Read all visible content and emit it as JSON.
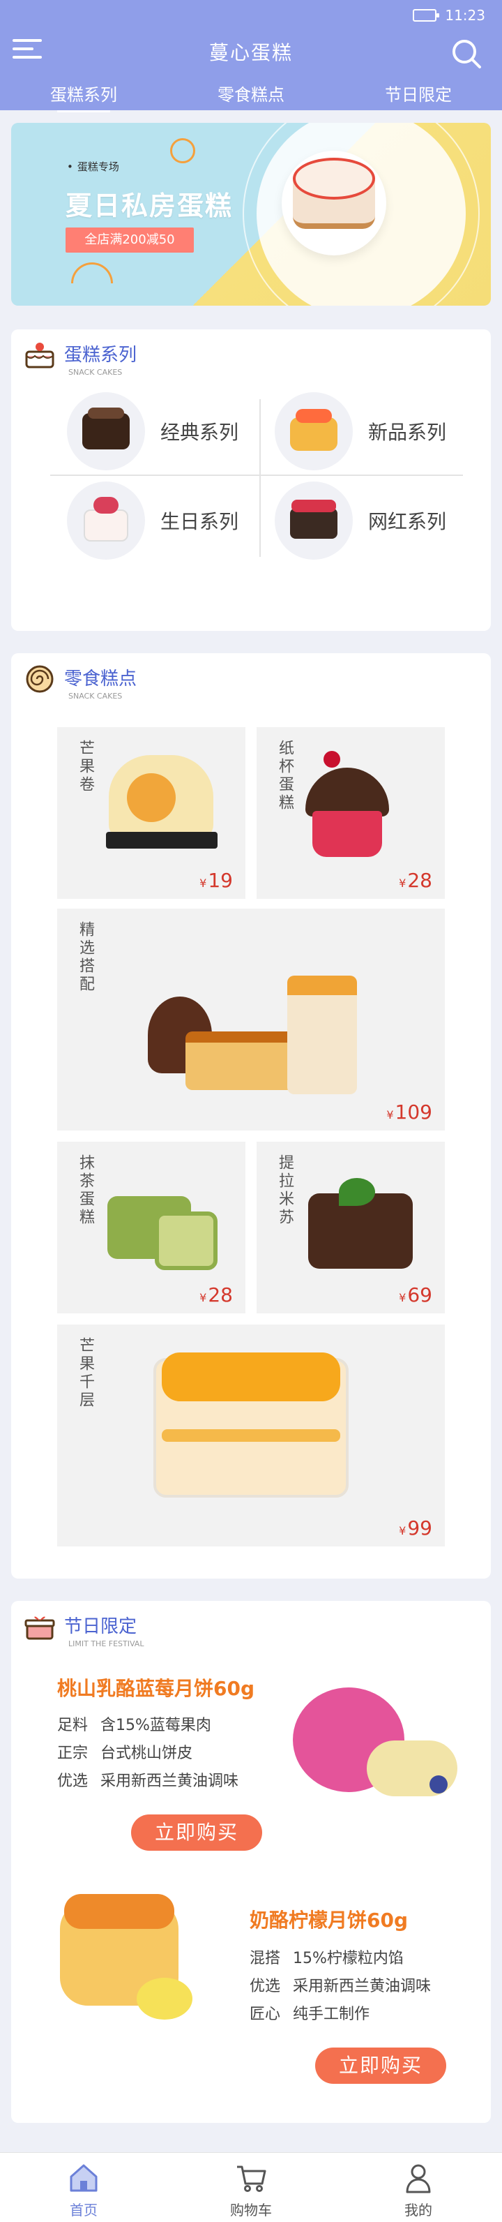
{
  "status_bar": {
    "time": "11:23"
  },
  "header": {
    "title": "蔓心蛋糕",
    "tabs": [
      {
        "label": "蛋糕系列",
        "active": true
      },
      {
        "label": "零食糕点",
        "active": false
      },
      {
        "label": "节日限定",
        "active": false
      }
    ]
  },
  "banner": {
    "subtitle": "蛋糕专场",
    "title": "夏日私房蛋糕",
    "promo": "全店满200减50"
  },
  "cake_series": {
    "title": "蛋糕系列",
    "subtitle": "SNACK CAKES",
    "items": [
      {
        "label": "经典系列"
      },
      {
        "label": "新品系列"
      },
      {
        "label": "生日系列"
      },
      {
        "label": "网红系列"
      }
    ]
  },
  "snacks": {
    "title": "零食糕点",
    "subtitle": "SNACK CAKES",
    "currency": "¥",
    "items": [
      {
        "name": "芒果卷",
        "price": "19"
      },
      {
        "name": "纸杯蛋糕",
        "price": "28"
      },
      {
        "name": "精选搭配",
        "price": "109"
      },
      {
        "name": "抹茶蛋糕",
        "price": "28"
      },
      {
        "name": "提拉米苏",
        "price": "69"
      },
      {
        "name": "芒果千层",
        "price": "99"
      }
    ]
  },
  "festival": {
    "title": "节日限定",
    "subtitle": "LIMIT THE FESTIVAL",
    "products": [
      {
        "name": "桃山乳酪蓝莓月饼60g",
        "details": [
          {
            "key": "足料",
            "value": "含15%蓝莓果肉"
          },
          {
            "key": "正宗",
            "value": "台式桃山饼皮"
          },
          {
            "key": "优选",
            "value": "采用新西兰黄油调味"
          }
        ],
        "button": "立即购买"
      },
      {
        "name": "奶酪柠檬月饼60g",
        "details": [
          {
            "key": "混搭",
            "value": "15%柠檬粒内馅"
          },
          {
            "key": "优选",
            "value": "采用新西兰黄油调味"
          },
          {
            "key": "匠心",
            "value": "纯手工制作"
          }
        ],
        "button": "立即购买"
      }
    ]
  },
  "bottom_nav": [
    {
      "label": "首页",
      "icon": "home-icon",
      "active": true
    },
    {
      "label": "购物车",
      "icon": "cart-icon",
      "active": false
    },
    {
      "label": "我的",
      "icon": "user-icon",
      "active": false
    }
  ],
  "colors": {
    "header": "#8f9ee9",
    "accent": "#4b63d0",
    "price": "#d4382c",
    "button": "#f4704f",
    "festival_title": "#f07b22"
  }
}
